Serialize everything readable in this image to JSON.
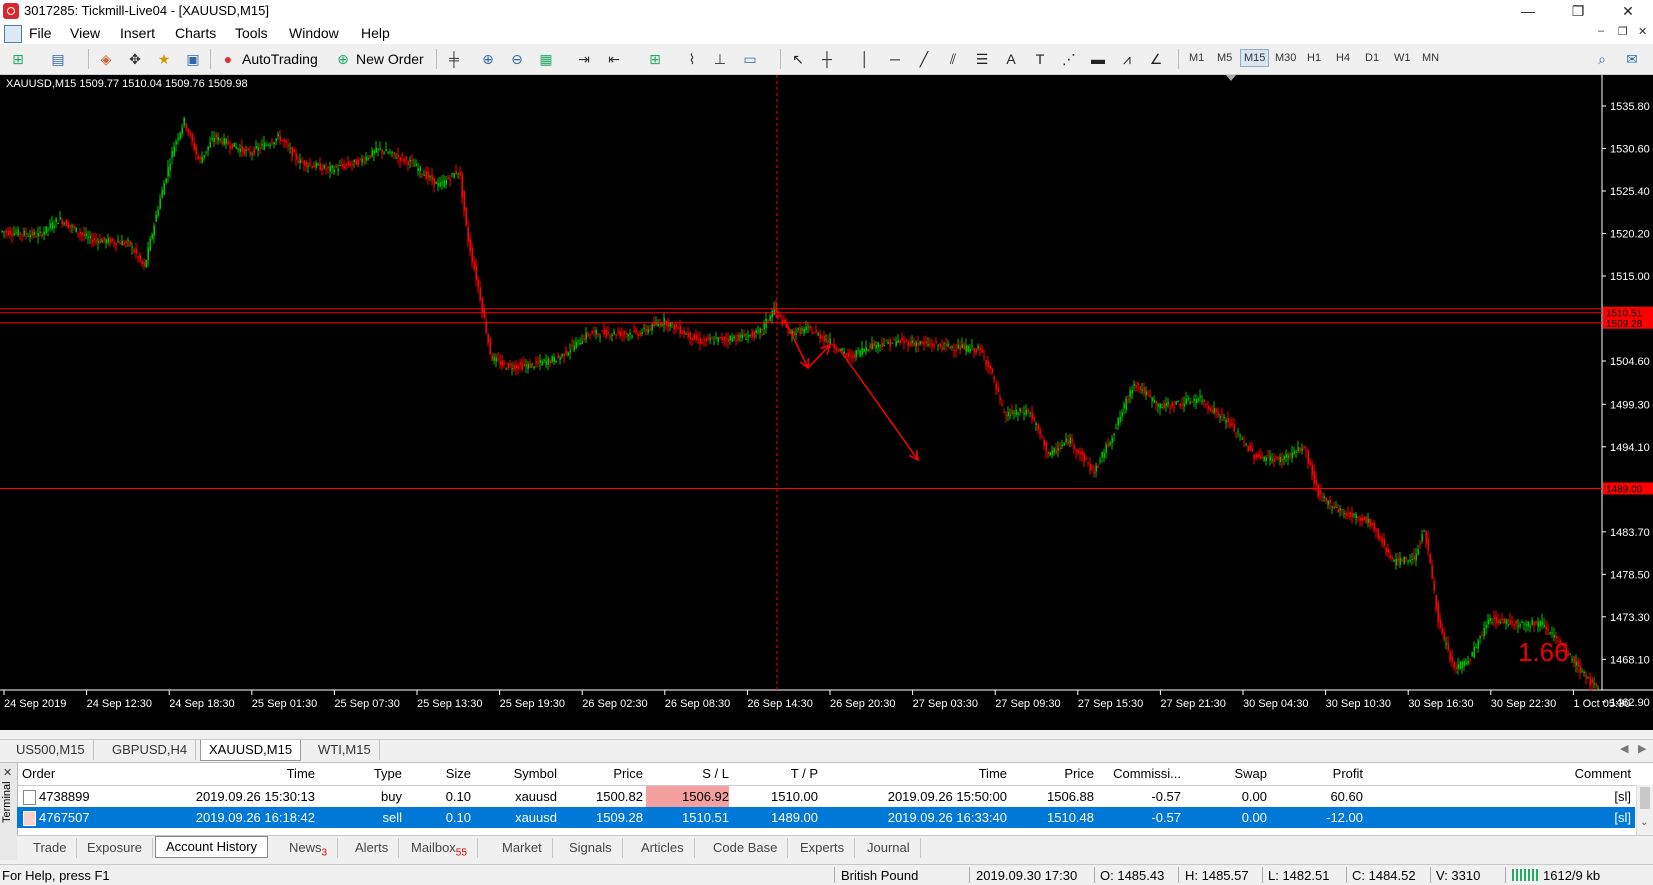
{
  "window": {
    "title": "3017285: Tickmill-Live04 - [XAUUSD,M15]",
    "minimize": "—",
    "restore": "❐",
    "close": "✕"
  },
  "menu": {
    "items": [
      "File",
      "View",
      "Insert",
      "Charts",
      "Tools",
      "Window",
      "Help"
    ]
  },
  "toolbar": {
    "autotrading_label": "AutoTrading",
    "new_order_label": "New Order",
    "timeframes": [
      "M1",
      "M5",
      "M15",
      "M30",
      "H1",
      "H4",
      "D1",
      "W1",
      "MN"
    ],
    "active_timeframe": "M15"
  },
  "chart": {
    "info": "XAUUSD,M15  1509.77 1510.04 1509.76 1509.98",
    "big_number": "1.66",
    "colors": {
      "up": "#00c000",
      "down": "#ff0000",
      "line": "#ff0000",
      "bg": "#000000"
    },
    "price_labels": [
      "1535.80",
      "1530.60",
      "1525.40",
      "1520.20",
      "1515.00",
      "1504.60",
      "1499.30",
      "1494.10",
      "1483.70",
      "1478.50",
      "1473.30",
      "1468.10",
      "1462.90"
    ],
    "marker_labels": [
      "1510.51",
      "1509.28",
      "1489.00"
    ],
    "time_labels": [
      "24 Sep 2019",
      "24 Sep 12:30",
      "24 Sep 18:30",
      "25 Sep 01:30",
      "25 Sep 07:30",
      "25 Sep 13:30",
      "25 Sep 19:30",
      "26 Sep 02:30",
      "26 Sep 08:30",
      "26 Sep 14:30",
      "26 Sep 20:30",
      "27 Sep 03:30",
      "27 Sep 09:30",
      "27 Sep 15:30",
      "27 Sep 21:30",
      "30 Sep 04:30",
      "30 Sep 10:30",
      "30 Sep 16:30",
      "30 Sep 22:30",
      "1 Oct 05:30"
    ]
  },
  "chart_tabs": {
    "items": [
      "US500,M15",
      "GBPUSD,H4",
      "XAUUSD,M15",
      "WTI,M15"
    ],
    "active": "XAUUSD,M15"
  },
  "terminal": {
    "side_label": "Terminal",
    "headers": {
      "order": "Order",
      "time": "Time",
      "type": "Type",
      "size": "Size",
      "symbol": "Symbol",
      "price": "Price",
      "sl": "S / L",
      "tp": "T / P",
      "close_time": "Time",
      "close_price": "Price",
      "commission": "Commissi...",
      "swap": "Swap",
      "profit": "Profit",
      "comment": "Comment"
    },
    "rows": [
      {
        "order": "4738899",
        "time": "2019.09.26 15:30:13",
        "type": "buy",
        "size": "0.10",
        "symbol": "xauusd",
        "price": "1500.82",
        "sl": "1506.92",
        "tp": "1510.00",
        "close_time": "2019.09.26 15:50:00",
        "close_price": "1506.88",
        "commission": "-0.57",
        "swap": "0.00",
        "profit": "60.60",
        "comment": "[sl]"
      },
      {
        "order": "4767507",
        "time": "2019.09.26 16:18:42",
        "type": "sell",
        "size": "0.10",
        "symbol": "xauusd",
        "price": "1509.28",
        "sl": "1510.51",
        "tp": "1489.00",
        "close_time": "2019.09.26 16:33:40",
        "close_price": "1510.48",
        "commission": "-0.57",
        "swap": "0.00",
        "profit": "-12.00",
        "comment": "[sl]"
      }
    ],
    "tabs": [
      {
        "label": "Trade"
      },
      {
        "label": "Exposure"
      },
      {
        "label": "Account History"
      },
      {
        "label": "News",
        "badge": "3"
      },
      {
        "label": "Alerts"
      },
      {
        "label": "Mailbox",
        "badge": "55"
      },
      {
        "label": "Market"
      },
      {
        "label": "Signals"
      },
      {
        "label": "Articles"
      },
      {
        "label": "Code Base"
      },
      {
        "label": "Experts"
      },
      {
        "label": "Journal"
      }
    ],
    "active_tab": "Account History"
  },
  "status": {
    "help": "For Help, press F1",
    "profile": "British Pound",
    "datetime": "2019.09.30 17:30",
    "open": "O: 1485.43",
    "high": "H: 1485.57",
    "low": "L: 1482.51",
    "close": "C: 1484.52",
    "volume": "V: 3310",
    "traffic": "1612/9 kb"
  }
}
